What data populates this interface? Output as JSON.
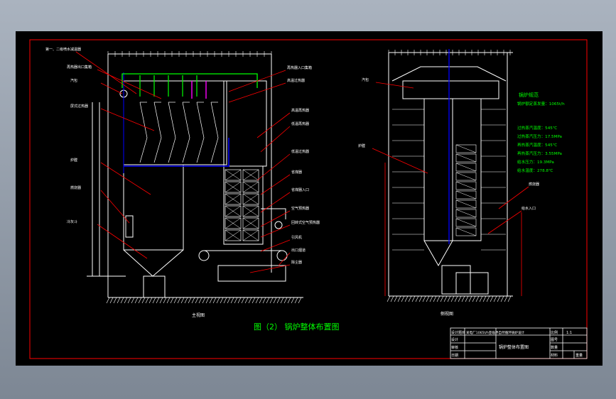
{
  "drawing": {
    "figure_title": "图（2） 锅炉整体布置图",
    "front_view_caption": "主视图",
    "side_view_caption": "侧视图",
    "front_view_callouts": [
      "第一、二级喷水减温器",
      "再热器出口集箱",
      "汽包",
      "屏式过热器",
      "炉膛",
      "燃烧器",
      "冷灰斗",
      "再热器入口集箱",
      "高温过热器",
      "高温再热器",
      "低温再热器",
      "低温过热器",
      "省煤器",
      "省煤器入口",
      "空气预热器",
      "回转式空气预热器",
      "引风机",
      "出口烟道",
      "除尘器"
    ],
    "side_view_callouts": [
      "汽包",
      "炉膛",
      "燃烧器",
      "给水入口"
    ],
    "specs": {
      "heading": "锅炉规范",
      "lines": [
        "锅炉额定蒸发量：1065t/h",
        "过热蒸汽温度：545℃",
        "过热蒸汽压力：17.5MPa",
        "再热蒸汽温度：545℃",
        "再热蒸汽压力：3.55MPa",
        "给水压力：19.3MPa",
        "给水温度：278.8℃"
      ]
    },
    "title_block": {
      "project_label": "设计题目",
      "project_value": "某电厂1065t/h亚临界自然循环锅炉设计",
      "drawing_name": "锅炉整体布置图",
      "scale_label": "比例",
      "scale_value": "1:1",
      "designer_label": "设计",
      "checker_label": "审核",
      "sheet_label": "图号",
      "quantity_label": "数量",
      "weight_label": "重量",
      "material_label": "材料",
      "date_label": "日期"
    },
    "colors": {
      "background": "#000000",
      "frame": "#ff0000",
      "structure": "#ffffff",
      "ducts": "#0000ff",
      "steam_pipes": "#00ff00",
      "reheat_pipes": "#ff00ff",
      "text": "#ffffff",
      "specs_text": "#00ff00"
    }
  }
}
